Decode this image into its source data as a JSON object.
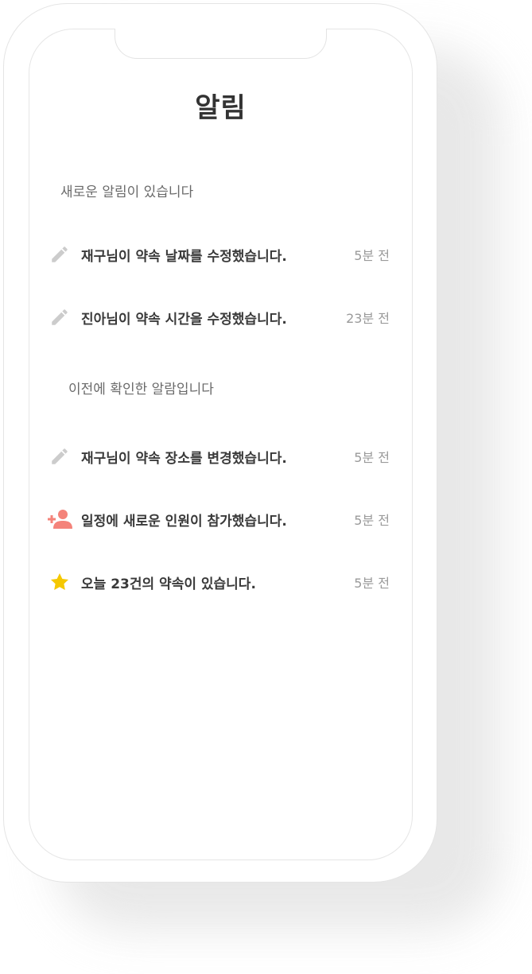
{
  "header": {
    "title": "알림"
  },
  "sections": {
    "new_label": "새로운 알림이 있습니다",
    "previous_label": "이전에 확인한 알람입니다"
  },
  "new_notifications": [
    {
      "icon": "pencil-icon",
      "message": "재구님이 약속 날짜를 수정했습니다.",
      "time": "5분 전"
    },
    {
      "icon": "pencil-icon",
      "message": "진아님이 약속 시간을 수정했습니다.",
      "time": "23분 전"
    }
  ],
  "previous_notifications": [
    {
      "icon": "pencil-icon",
      "message": "재구님이 약속 장소를 변경했습니다.",
      "time": "5분 전"
    },
    {
      "icon": "add-person-icon",
      "message": "일정에 새로운 인원이 참가했습니다.",
      "time": "5분 전"
    },
    {
      "icon": "star-icon",
      "message": "오늘 23건의 약속이 있습니다.",
      "time": "5분 전"
    }
  ],
  "colors": {
    "pencil": "#cccccc",
    "add_person": "#f4837a",
    "star": "#f5c800",
    "title": "#333333"
  }
}
